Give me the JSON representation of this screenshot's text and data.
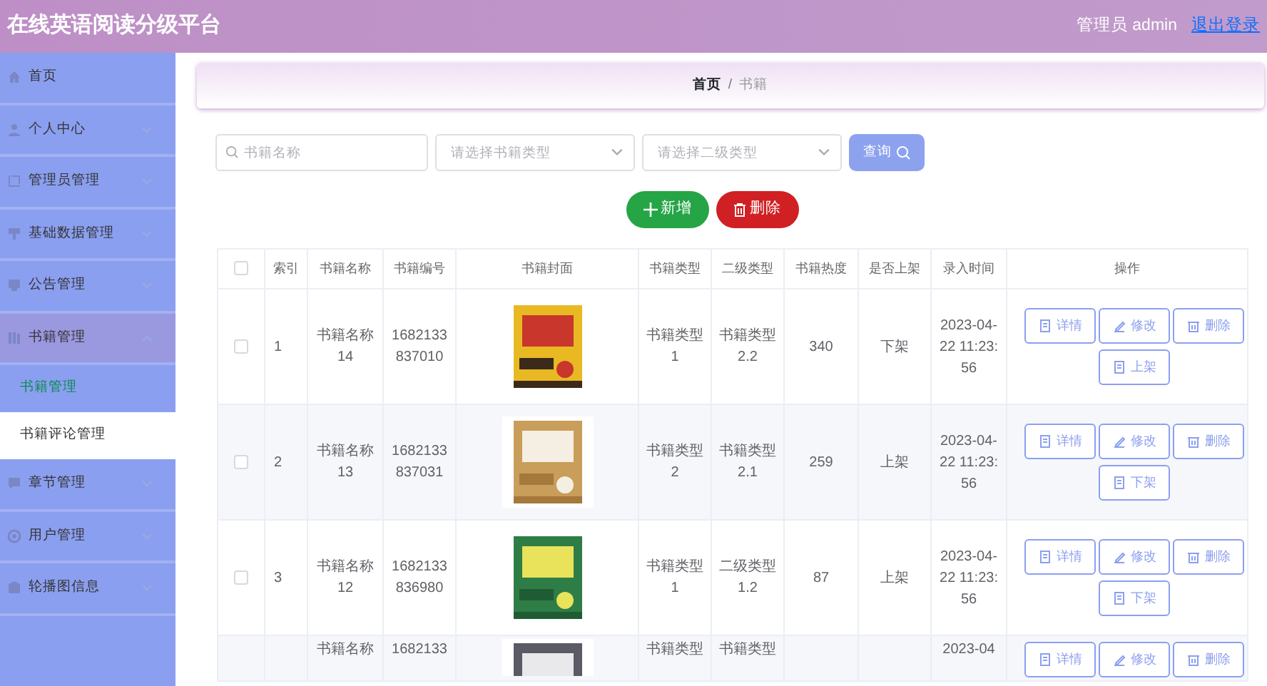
{
  "header": {
    "title": "在线英语阅读分级平台",
    "user": "管理员 admin",
    "logout": "退出登录"
  },
  "sidebar": {
    "items": [
      {
        "label": "首页",
        "expandable": false,
        "expanded": false
      },
      {
        "label": "个人中心",
        "expandable": true,
        "expanded": false
      },
      {
        "label": "管理员管理",
        "expandable": true,
        "expanded": false
      },
      {
        "label": "基础数据管理",
        "expandable": true,
        "expanded": false
      },
      {
        "label": "公告管理",
        "expandable": true,
        "expanded": false
      },
      {
        "label": "书籍管理",
        "expandable": true,
        "expanded": true,
        "children": [
          {
            "label": "书籍管理",
            "selected": true,
            "hover": false
          },
          {
            "label": "书籍评论管理",
            "selected": false,
            "hover": true
          }
        ]
      },
      {
        "label": "章节管理",
        "expandable": true,
        "expanded": false
      },
      {
        "label": "用户管理",
        "expandable": true,
        "expanded": false
      },
      {
        "label": "轮播图信息",
        "expandable": true,
        "expanded": false
      }
    ]
  },
  "breadcrumb": {
    "items": [
      "首页",
      "书籍"
    ],
    "separator": "/"
  },
  "filters": {
    "search": {
      "placeholder": "书籍名称"
    },
    "selects": [
      {
        "placeholder": "请选择书籍类型"
      },
      {
        "placeholder": "请选择二级类型"
      }
    ],
    "query_button": "查询"
  },
  "actions": {
    "add": "新增",
    "delete": "删除"
  },
  "table": {
    "select_all": {
      "checked": false
    },
    "columns": [
      "索引",
      "书籍名称",
      "书籍编号",
      "书籍封面",
      "书籍类型",
      "二级类型",
      "书籍热度",
      "是否上架",
      "录入时间",
      "操作"
    ],
    "rows": [
      {
        "checked": false,
        "index": "1",
        "name": "书籍名称14",
        "code": "1682133837010",
        "cover": {
          "kind": "picture"
        },
        "type": "书籍类型1",
        "subtype": "书籍类型2.2",
        "heat": "340",
        "shelf": "下架",
        "time": "2023-04-22 11:23:56",
        "buttons": [
          "详情",
          "修改",
          "删除",
          "上架"
        ]
      },
      {
        "checked": false,
        "index": "2",
        "name": "书籍名称13",
        "code": "1682133837031",
        "cover": {
          "kind": "picture"
        },
        "type": "书籍类型2",
        "subtype": "书籍类型2.1",
        "heat": "259",
        "shelf": "上架",
        "time": "2023-04-22 11:23:56",
        "buttons": [
          "详情",
          "修改",
          "删除",
          "下架"
        ]
      },
      {
        "checked": false,
        "index": "3",
        "name": "书籍名称12",
        "code": "1682133836980",
        "cover": {
          "kind": "picture"
        },
        "type": "书籍类型1",
        "subtype": "二级类型1.2",
        "heat": "87",
        "shelf": "上架",
        "time": "2023-04-22 11:23:56",
        "buttons": [
          "详情",
          "修改",
          "删除",
          "下架"
        ]
      },
      {
        "name": "书籍名称",
        "code": "1682133",
        "cover": {
          "kind": "picture"
        },
        "type": "书籍类型",
        "subtype": "书籍类型",
        "time": "2023-04",
        "buttons": [
          "详情",
          "修改",
          "删除"
        ]
      }
    ]
  }
}
